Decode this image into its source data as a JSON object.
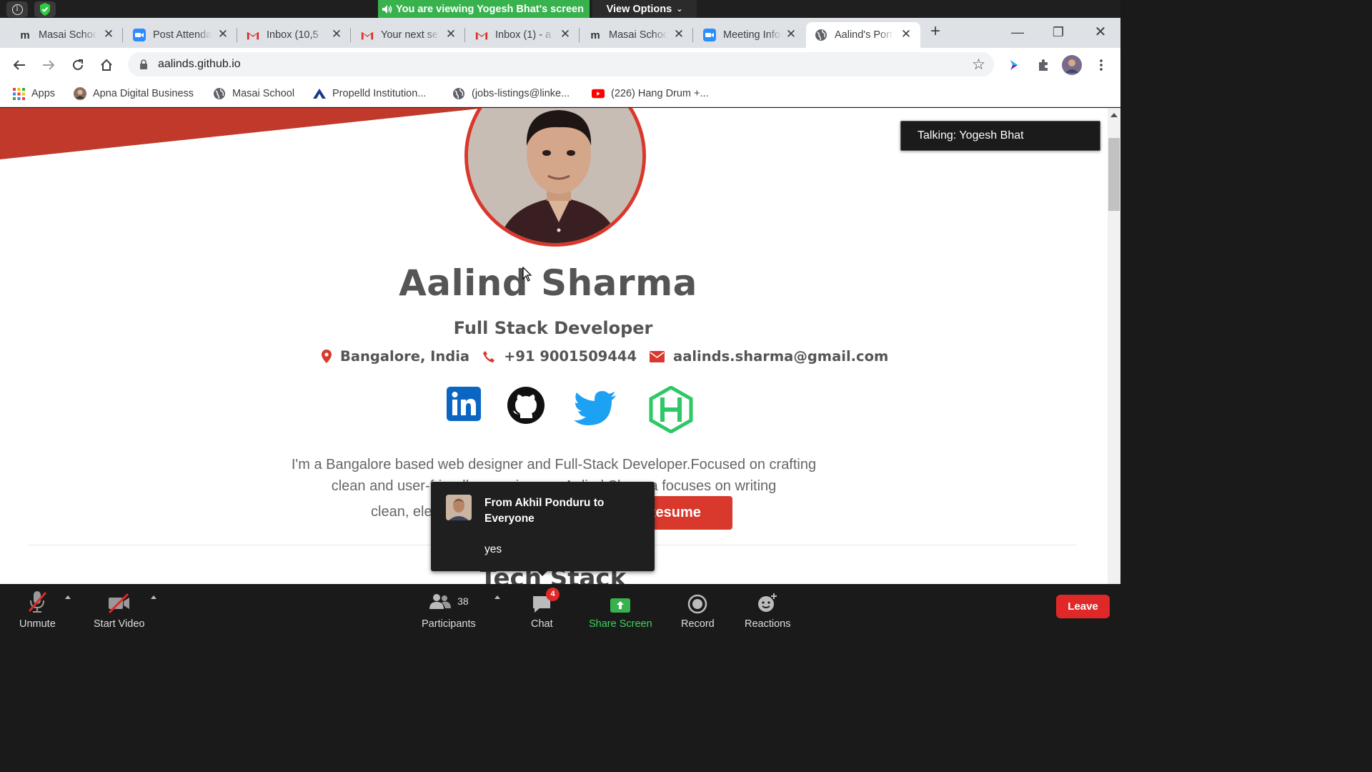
{
  "zoom": {
    "viewing_banner": "You are viewing Yogesh Bhat's screen",
    "view_options": "View Options",
    "talking": "Talking: Yogesh Bhat",
    "controls": {
      "unmute": "Unmute",
      "start_video": "Start Video",
      "participants": "Participants",
      "participants_count": "38",
      "chat": "Chat",
      "chat_badge": "4",
      "share_screen": "Share Screen",
      "record": "Record",
      "reactions": "Reactions",
      "leave": "Leave"
    },
    "chat_popup": {
      "from": "From Akhil Ponduru to Everyone",
      "message": "yes"
    },
    "colors": {
      "share_green": "#37b24d",
      "leave_red": "#e02828"
    }
  },
  "browser": {
    "tabs": [
      {
        "title": "Masai School",
        "icon": "masai-m-icon"
      },
      {
        "title": "Post Attendance",
        "icon": "zoom-icon"
      },
      {
        "title": "Inbox (10,5",
        "icon": "gmail-icon"
      },
      {
        "title": "Your next session",
        "icon": "gmail-icon"
      },
      {
        "title": "Inbox (1) - a",
        "icon": "gmail-icon"
      },
      {
        "title": "Masai School",
        "icon": "masai-m-icon"
      },
      {
        "title": "Meeting Information",
        "icon": "zoom-icon"
      },
      {
        "title": "Aalind's Portfolio",
        "icon": "globe-icon"
      }
    ],
    "url": "aalinds.github.io",
    "bookmarks": [
      {
        "label": "Apps",
        "icon": "apps-grid-icon"
      },
      {
        "label": "Apna Digital Business",
        "icon": "profile-icon"
      },
      {
        "label": "Masai School",
        "icon": "globe-icon"
      },
      {
        "label": "Propelld Institution...",
        "icon": "propelld-icon"
      },
      {
        "label": "(jobs-listings@linke...",
        "icon": "globe-icon"
      },
      {
        "label": "(226) Hang Drum +...",
        "icon": "youtube-icon"
      }
    ]
  },
  "portfolio": {
    "name": "Aalind Sharma",
    "role": "Full Stack Developer",
    "location": "Bangalore, India",
    "phone": "+91 9001509444",
    "email": "aalinds.sharma@gmail.com",
    "bio_line1": "I'm a Bangalore based web designer and Full-Stack Developer.Focused on crafting",
    "bio_line2": "clean and user-friendly experiences. Aalind Sharma focuses on writing",
    "bio_line3": "clean, ele",
    "resume_button": "Download Resume",
    "section_heading": "Tech Stack",
    "accent_color": "#d9382c"
  }
}
